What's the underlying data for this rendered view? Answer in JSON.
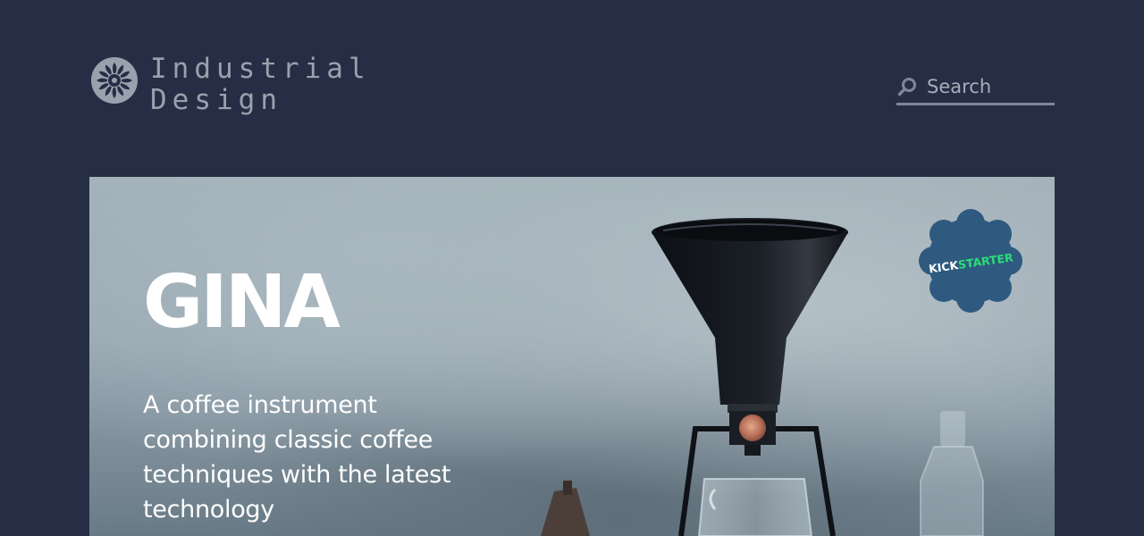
{
  "brand": {
    "line1": "Industrial",
    "line2": "Design",
    "logo_icon": "turbine-icon"
  },
  "search": {
    "placeholder": "Search",
    "value": "",
    "icon": "search-icon"
  },
  "hero": {
    "title": "GINA",
    "description": "A coffee instrument combining classic coffee techniques with the latest technology",
    "badge_text": "KICKSTARTER",
    "colors": {
      "badge_bg": "#2e5a80",
      "badge_text": "#2bde73"
    }
  },
  "colors": {
    "page_bg": "#262e45",
    "brand_text": "#9aa1ad",
    "search_underline": "#7f8797"
  }
}
